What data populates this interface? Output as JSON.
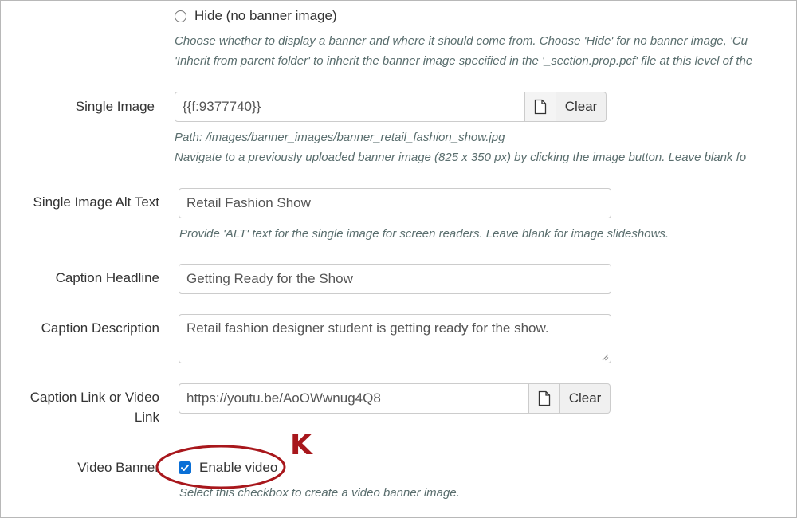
{
  "banner_option": {
    "hide_label": "Hide (no banner image)",
    "help_line1": "Choose whether to display a banner and where it should come from. Choose 'Hide' for no banner image, 'Cu",
    "help_line2": "'Inherit from parent folder' to inherit the banner image specified in the '_section.prop.pcf' file at this level of the"
  },
  "single_image": {
    "label": "Single Image",
    "value": "{{f:9377740}}",
    "clear_label": "Clear",
    "path_text": "Path: /images/banner_images/banner_retail_fashion_show.jpg",
    "help": "Navigate to a previously uploaded banner image (825 x 350 px) by clicking the image button. Leave blank fo"
  },
  "alt_text": {
    "label": "Single Image Alt Text",
    "value": "Retail Fashion Show",
    "help": "Provide 'ALT' text for the single image for screen readers. Leave blank for image slideshows."
  },
  "caption_headline": {
    "label": "Caption Headline",
    "value": "Getting Ready for the Show"
  },
  "caption_description": {
    "label": "Caption Description",
    "value": "Retail fashion designer student is getting ready for the show."
  },
  "caption_link": {
    "label_line1": "Caption Link or Video",
    "label_line2": "Link",
    "value": "https://youtu.be/AoOWwnug4Q8",
    "clear_label": "Clear"
  },
  "video_banner": {
    "label": "Video Banner",
    "checkbox_label": "Enable video",
    "checked": true,
    "help": "Select this checkbox to create a video banner image."
  },
  "annotation": {
    "letter": "K",
    "color": "#a8171c"
  },
  "colors": {
    "checkbox_accent": "#0a6fd6",
    "help_text": "#5a6e6e",
    "input_border": "#cccccc"
  }
}
